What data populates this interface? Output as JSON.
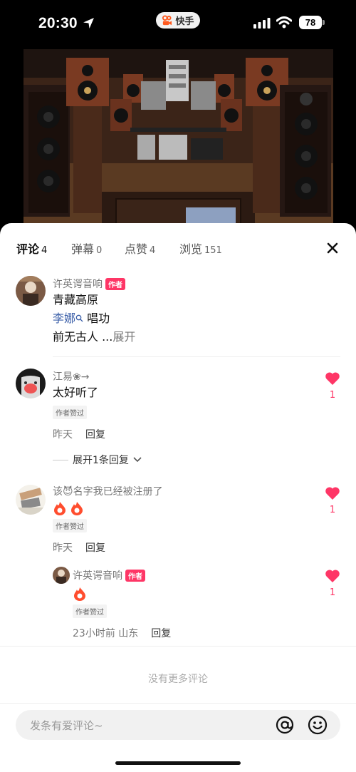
{
  "status_bar": {
    "time": "20:30",
    "app_name": "快手",
    "battery": "78"
  },
  "tabs": [
    {
      "label": "评论",
      "count": "4"
    },
    {
      "label": "弹幕",
      "count": "0"
    },
    {
      "label": "点赞",
      "count": "4"
    },
    {
      "label": "浏览",
      "count": "151"
    }
  ],
  "comments": [
    {
      "user": "许英谔音响",
      "badge": "作者",
      "line1": "青藏高原",
      "mention": "李娜",
      "line2_rest": "唱功",
      "line3": "前无古人 ...",
      "expand": "展开"
    },
    {
      "user": "江易❀→",
      "text": "太好听了",
      "liked_tag": "作者赞过",
      "time": "昨天",
      "reply": "回复",
      "likes": "1",
      "expand_replies": "展开1条回复"
    },
    {
      "user": "该😈名字我已经被注册了",
      "liked_tag": "作者赞过",
      "time": "昨天",
      "reply": "回复",
      "likes": "1"
    }
  ],
  "reply": {
    "user": "许英谔音响",
    "badge": "作者",
    "liked_tag": "作者赞过",
    "time_location": "23小时前 山东",
    "reply": "回复",
    "likes": "1"
  },
  "no_more": "没有更多评论",
  "input": {
    "placeholder": "发条有爱评论~"
  },
  "colors": {
    "accent": "#fe3666",
    "mention": "#3a5ea8"
  }
}
